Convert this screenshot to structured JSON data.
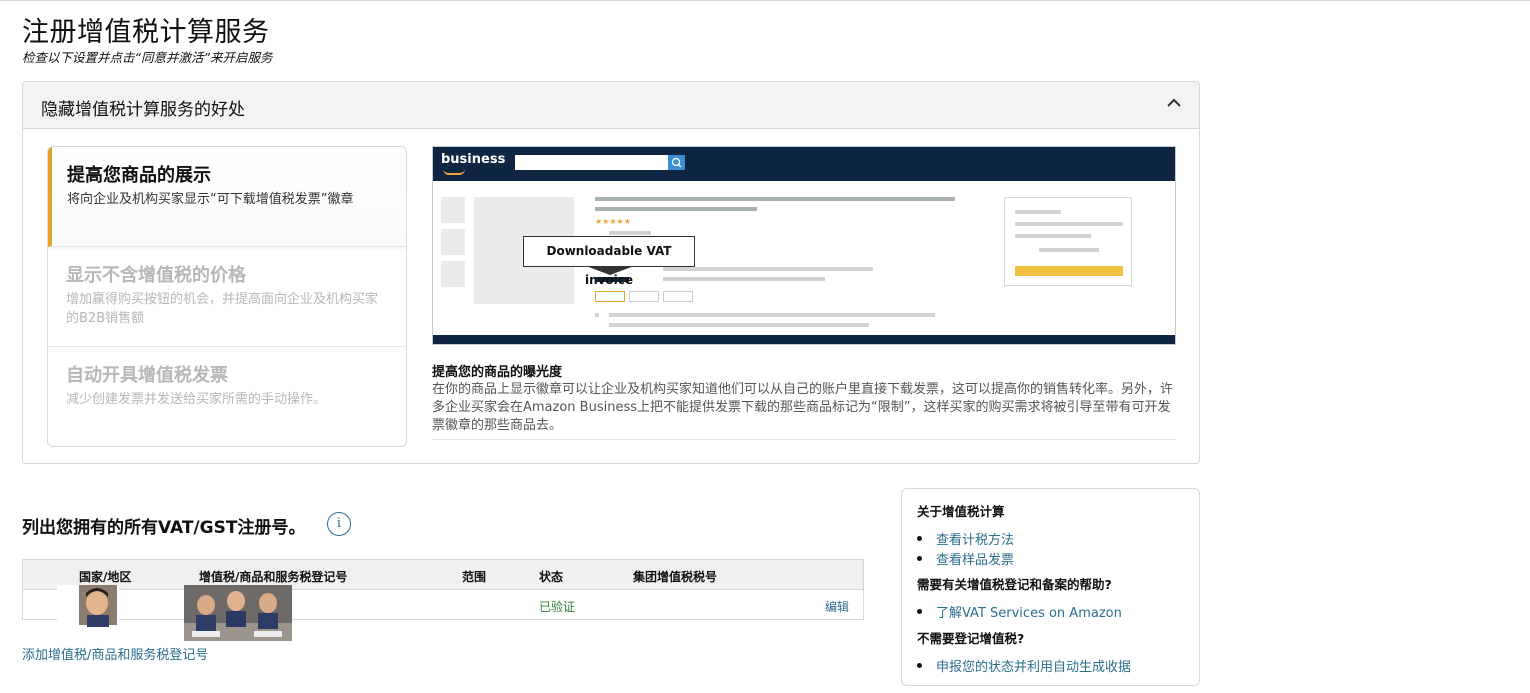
{
  "page": {
    "title": "注册增值税计算服务",
    "subtitle": "检查以下设置并点击“同意并激活”来开启服务"
  },
  "benefits": {
    "header_label": "隐藏增值税计算服务的好处",
    "items": [
      {
        "title": "提高您商品的展示",
        "desc": "将向企业及机构买家显示“可下载增值税发票”徽章",
        "active": true
      },
      {
        "title": "显示不含增值税的价格",
        "desc": "增加赢得购买按钮的机会，并提高面向企业及机构买家的B2B销售额",
        "active": false
      },
      {
        "title": "自动开具增值税发票",
        "desc": "减少创建发票并发送给买家所需的手动操作。",
        "active": false
      }
    ],
    "preview": {
      "logo_text": "business",
      "badge_text": "Downloadable VAT invoice",
      "stars": "★★★★★"
    },
    "caption_title": "提高您的商品的曝光度",
    "caption_body": "在你的商品上显示徽章可以让企业及机构买家知道他们可以从自己的账户里直接下载发票，这可以提高你的销售转化率。另外，许多企业买家会在Amazon Business上把不能提供发票下载的那些商品标记为“限制”，这样买家的购买需求将被引导至带有可开发票徽章的那些商品去。"
  },
  "registrations": {
    "heading": "列出您拥有的所有VAT/GST注册号。",
    "info_icon": "i",
    "columns": [
      "国家/地区",
      "增值税/商品和服务税登记号",
      "范围",
      "状态",
      "集团增值税税号"
    ],
    "rows": [
      {
        "country": "",
        "number": "",
        "scope": "",
        "status": "已验证",
        "group": "",
        "action": "编辑"
      }
    ],
    "add_link": "添加增值税/商品和服务税登记号"
  },
  "help": {
    "sections": [
      {
        "title": "关于增值税计算",
        "links": [
          "查看计税方法",
          "查看样品发票"
        ]
      },
      {
        "title": "需要有关增值税登记和备案的帮助?",
        "links": [
          "了解VAT Services on Amazon"
        ]
      },
      {
        "title": "不需要登记增值税?",
        "links": [
          "申报您的状态并利用自动生成收据"
        ]
      }
    ]
  },
  "colors": {
    "accent": "#e3a32d",
    "link": "#2a6f8a",
    "verified": "#2e7d32",
    "navy": "#0f2642"
  }
}
